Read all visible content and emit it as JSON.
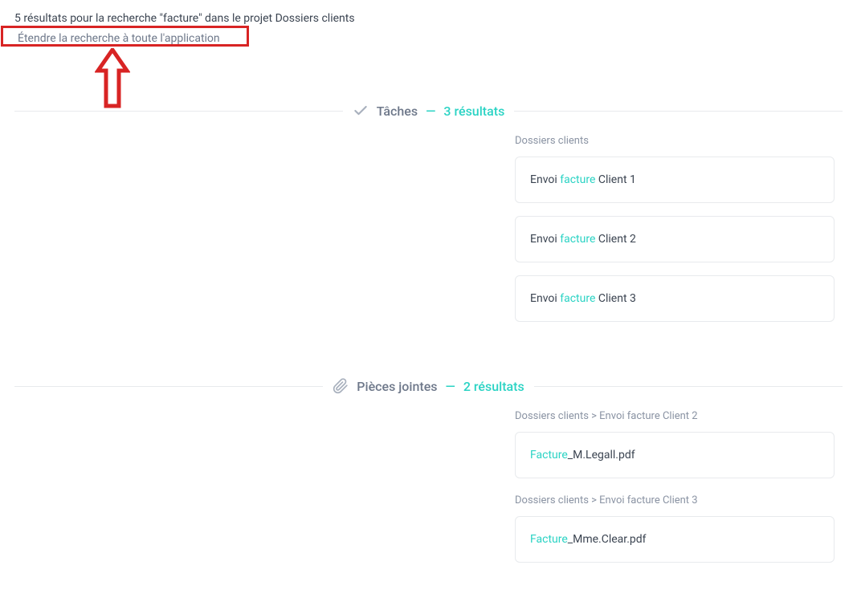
{
  "header": {
    "results_line_prefix": "5 résultats pour la recherche ",
    "results_line_quoted": "\"facture\"",
    "results_line_middle": " dans le projet ",
    "project_name": "Dossiers clients",
    "expand_search_label": "Étendre la recherche à toute l'application"
  },
  "sections": {
    "tasks": {
      "title": "Tâches",
      "count_label": "3 résultats",
      "group_label": "Dossiers clients",
      "items": [
        {
          "prefix": "Envoi ",
          "highlight": "facture",
          "suffix": " Client 1"
        },
        {
          "prefix": "Envoi ",
          "highlight": "facture",
          "suffix": " Client 2"
        },
        {
          "prefix": "Envoi ",
          "highlight": "facture",
          "suffix": " Client 3"
        }
      ]
    },
    "attachments": {
      "title": "Pièces jointes",
      "count_label": "2 résultats",
      "items": [
        {
          "breadcrumb": "Dossiers clients > Envoi facture Client 2",
          "file_highlight": "Facture",
          "file_suffix": "_M.Legall.pdf"
        },
        {
          "breadcrumb": "Dossiers clients > Envoi facture Client 3",
          "file_highlight": "Facture",
          "file_suffix": "_Mme.Clear.pdf"
        }
      ]
    }
  }
}
